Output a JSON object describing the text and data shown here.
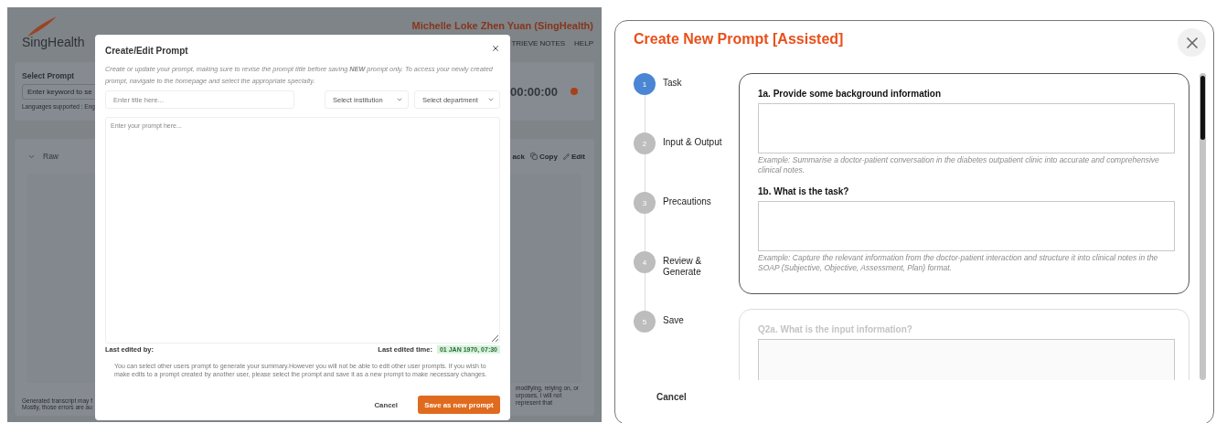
{
  "app": {
    "logo": "SingHealth",
    "user": "Michelle Loke Zhen Yuan (SingHealth)",
    "nav": [
      "TRIEVE NOTES",
      "HELP"
    ],
    "prompt_panel": {
      "label": "Select Prompt",
      "search_placeholder": "Enter keyword to se",
      "languages": "Languages supported : Eng",
      "timer": "00:00:00"
    },
    "transcript": {
      "tab": "Raw",
      "actions": [
        {
          "kind": "plain",
          "label": "ack"
        },
        {
          "kind": "copy",
          "label": "Copy"
        },
        {
          "kind": "edit",
          "label": "Edit"
        }
      ],
      "notice_left": [
        "Generated transcript may f",
        "Mostly, those errors are au"
      ],
      "notice_right": [
        "modifying, relying on, or",
        "urposes, I will not represent that"
      ]
    }
  },
  "edit_dialog": {
    "title": "Create/Edit Prompt",
    "description": "Create or update your prompt, making sure to revise the prompt title before saving **NEW** prompt only. To access your newly created prompt, navigate to the homepage and select the appropriate specialty.",
    "title_placeholder": "Enter title here...",
    "selects": [
      "Select institution",
      "Select department"
    ],
    "prompt_placeholder": "Enter your prompt here...",
    "last_edited_by_label": "Last edited by:",
    "last_edited_time_label": "Last edited time:",
    "last_edited_time": "01 JAN 1970, 07:30",
    "info": "You can select other users prompt to generate your summary.However you will not be able to edit other user prompts. If you wish to make edits to a prompt created by another user, please select the prompt and save it as a new prompt to make necessary changes.",
    "cancel": "Cancel",
    "save": "Save as new prompt"
  },
  "assisted_dialog": {
    "title": "Create New Prompt [Assisted]",
    "steps": [
      {
        "number": "1",
        "label": "Task",
        "selected": true
      },
      {
        "number": "2",
        "label": "Input & Output",
        "selected": false
      },
      {
        "number": "3",
        "label": "Precautions",
        "selected": false
      },
      {
        "number": "4",
        "label": "Review & Generate",
        "selected": false
      },
      {
        "number": "5",
        "label": "Save",
        "selected": false
      }
    ],
    "sections": [
      {
        "disabled": false,
        "questions": [
          {
            "label": "1a. Provide some background information",
            "example": "Example: Summarise a doctor-patient conversation in the diabetes outpatient clinic into accurate and comprehensive clinical notes."
          },
          {
            "label": "1b. What is the task?",
            "example": "Example: Capture the relevant information from the doctor-patient interaction and structure it into clinical notes in the SOAP (Subjective, Objective, Assessment, Plan) format."
          }
        ]
      },
      {
        "disabled": true,
        "questions": [
          {
            "label": "Q2a. What is the input information?"
          }
        ]
      }
    ],
    "cancel": "Cancel"
  }
}
